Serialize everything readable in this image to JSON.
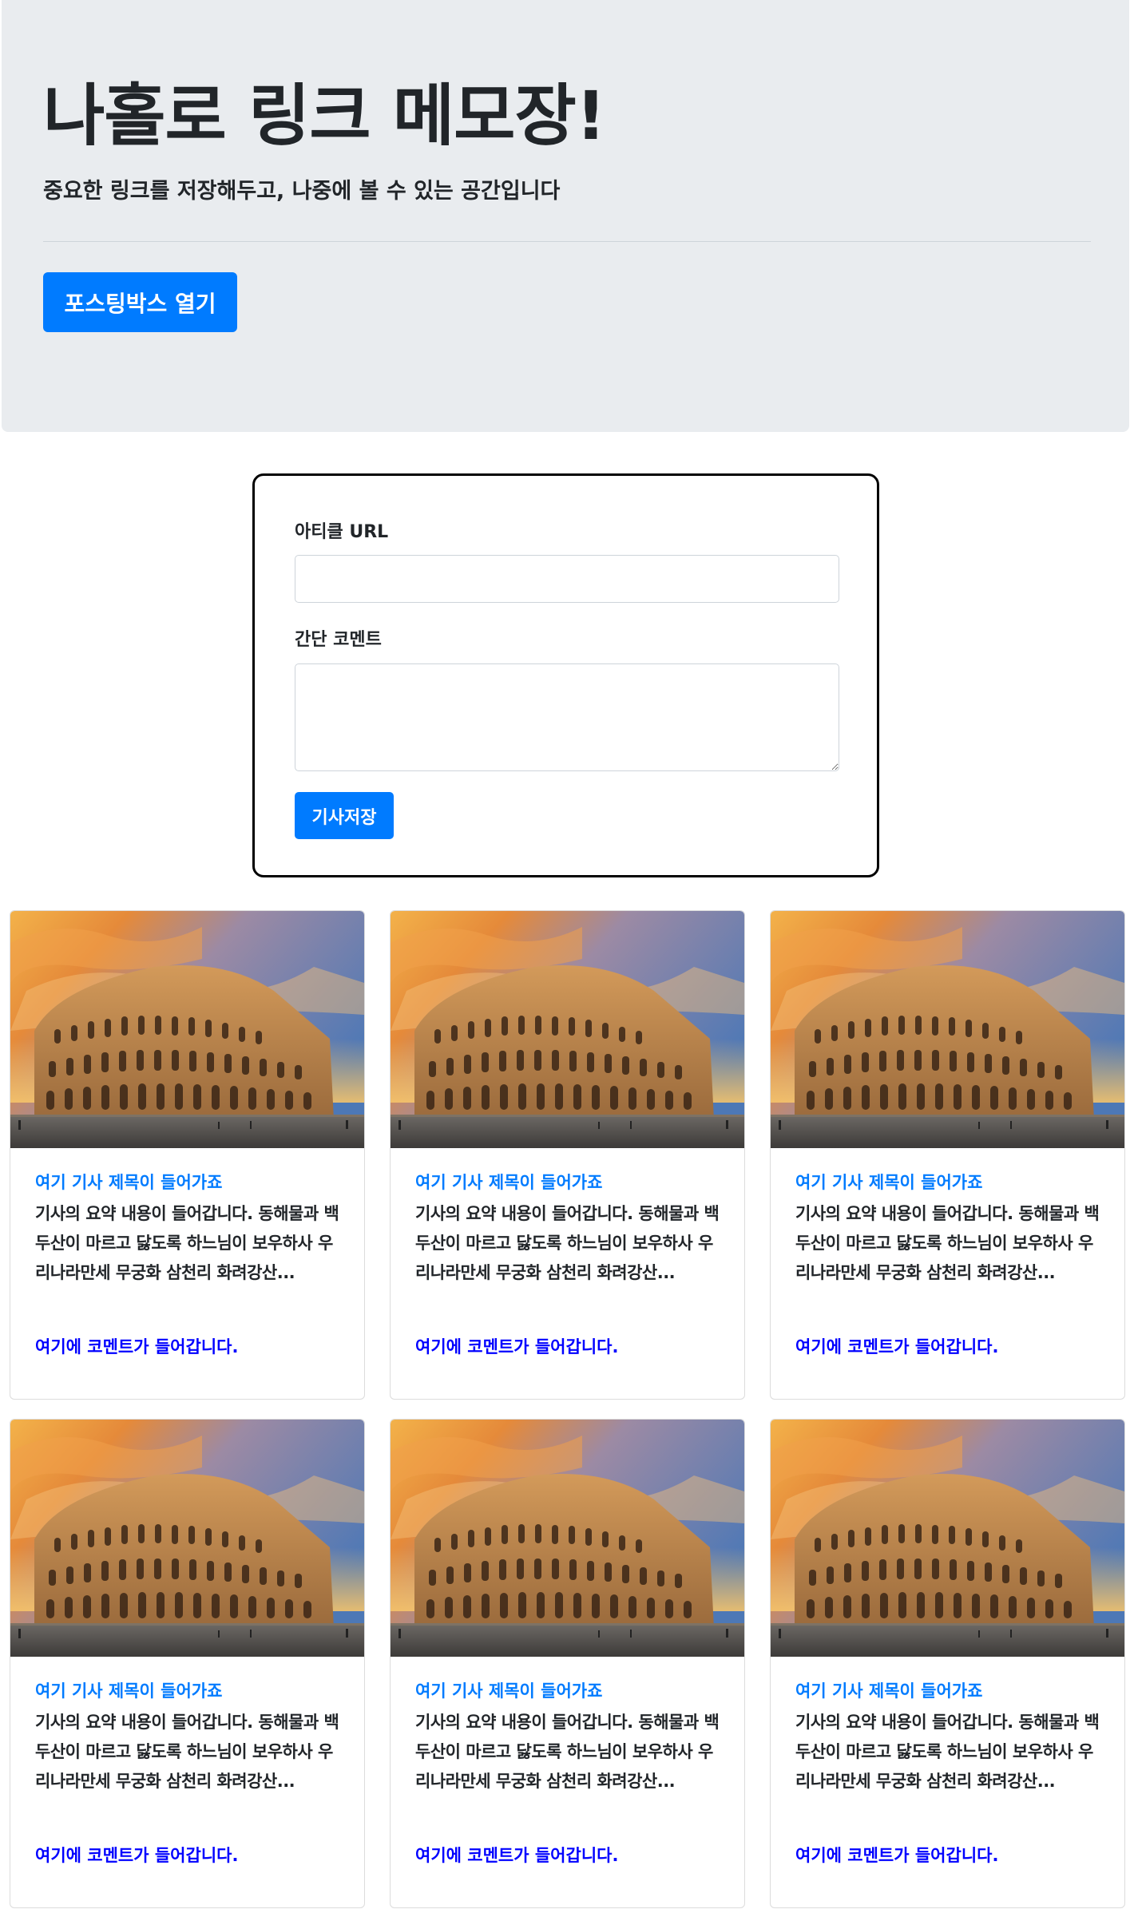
{
  "jumbotron": {
    "title": "나홀로 링크 메모장!",
    "lead": "중요한 링크를 저장해두고, 나중에 볼 수 있는 공간입니다",
    "open_button": "포스팅박스 열기"
  },
  "posting_box": {
    "url_label": "아티클 URL",
    "url_value": "",
    "comment_label": "간단 코멘트",
    "comment_value": "",
    "save_button": "기사저장"
  },
  "cards": [
    {
      "title": "여기 기사 제목이 들어가죠",
      "summary": "기사의 요약 내용이 들어갑니다. 동해물과 백두산이 마르고 닳도록 하느님이 보우하사 우리나라만세 무궁화 삼천리 화려강산...",
      "comment": "여기에 코멘트가 들어갑니다.",
      "image": "colosseum-photo"
    },
    {
      "title": "여기 기사 제목이 들어가죠",
      "summary": "기사의 요약 내용이 들어갑니다. 동해물과 백두산이 마르고 닳도록 하느님이 보우하사 우리나라만세 무궁화 삼천리 화려강산...",
      "comment": "여기에 코멘트가 들어갑니다.",
      "image": "colosseum-photo"
    },
    {
      "title": "여기 기사 제목이 들어가죠",
      "summary": "기사의 요약 내용이 들어갑니다. 동해물과 백두산이 마르고 닳도록 하느님이 보우하사 우리나라만세 무궁화 삼천리 화려강산...",
      "comment": "여기에 코멘트가 들어갑니다.",
      "image": "colosseum-photo"
    },
    {
      "title": "여기 기사 제목이 들어가죠",
      "summary": "기사의 요약 내용이 들어갑니다. 동해물과 백두산이 마르고 닳도록 하느님이 보우하사 우리나라만세 무궁화 삼천리 화려강산...",
      "comment": "여기에 코멘트가 들어갑니다.",
      "image": "colosseum-photo"
    },
    {
      "title": "여기 기사 제목이 들어가죠",
      "summary": "기사의 요약 내용이 들어갑니다. 동해물과 백두산이 마르고 닳도록 하느님이 보우하사 우리나라만세 무궁화 삼천리 화려강산...",
      "comment": "여기에 코멘트가 들어갑니다.",
      "image": "colosseum-photo"
    },
    {
      "title": "여기 기사 제목이 들어가죠",
      "summary": "기사의 요약 내용이 들어갑니다. 동해물과 백두산이 마르고 닳도록 하느님이 보우하사 우리나라만세 무궁화 삼천리 화려강산...",
      "comment": "여기에 코멘트가 들어갑니다.",
      "image": "colosseum-photo"
    }
  ],
  "colors": {
    "primary": "#007bff",
    "jumbotron_bg": "#e9ecef",
    "comment_text": "#0000ff"
  }
}
